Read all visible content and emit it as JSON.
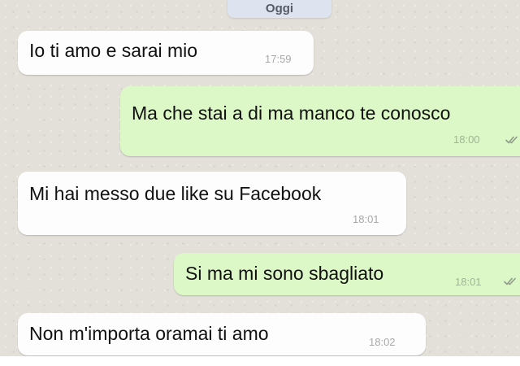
{
  "chat": {
    "day_label": "Oggi",
    "messages": [
      {
        "direction": "incoming",
        "text": "Io ti amo e sarai mio",
        "time": "17:59"
      },
      {
        "direction": "outgoing",
        "text": "Ma che stai a di ma manco te conosco",
        "time": "18:00",
        "status_icon": "double-check-icon"
      },
      {
        "direction": "incoming",
        "text": "Mi hai messo due like su Facebook",
        "time": "18:01"
      },
      {
        "direction": "outgoing",
        "text": "Si ma mi sono sbagliato",
        "time": "18:01",
        "status_icon": "double-check-icon"
      },
      {
        "direction": "incoming",
        "text": "Non m'importa oramai ti amo",
        "time": "18:02"
      }
    ]
  },
  "colors": {
    "background": "#e3dfd9",
    "incoming_bubble": "#fdfdfd",
    "outgoing_bubble": "#dcf8c6",
    "day_chip": "#dde4f0",
    "tick": "#8f9a8a"
  }
}
